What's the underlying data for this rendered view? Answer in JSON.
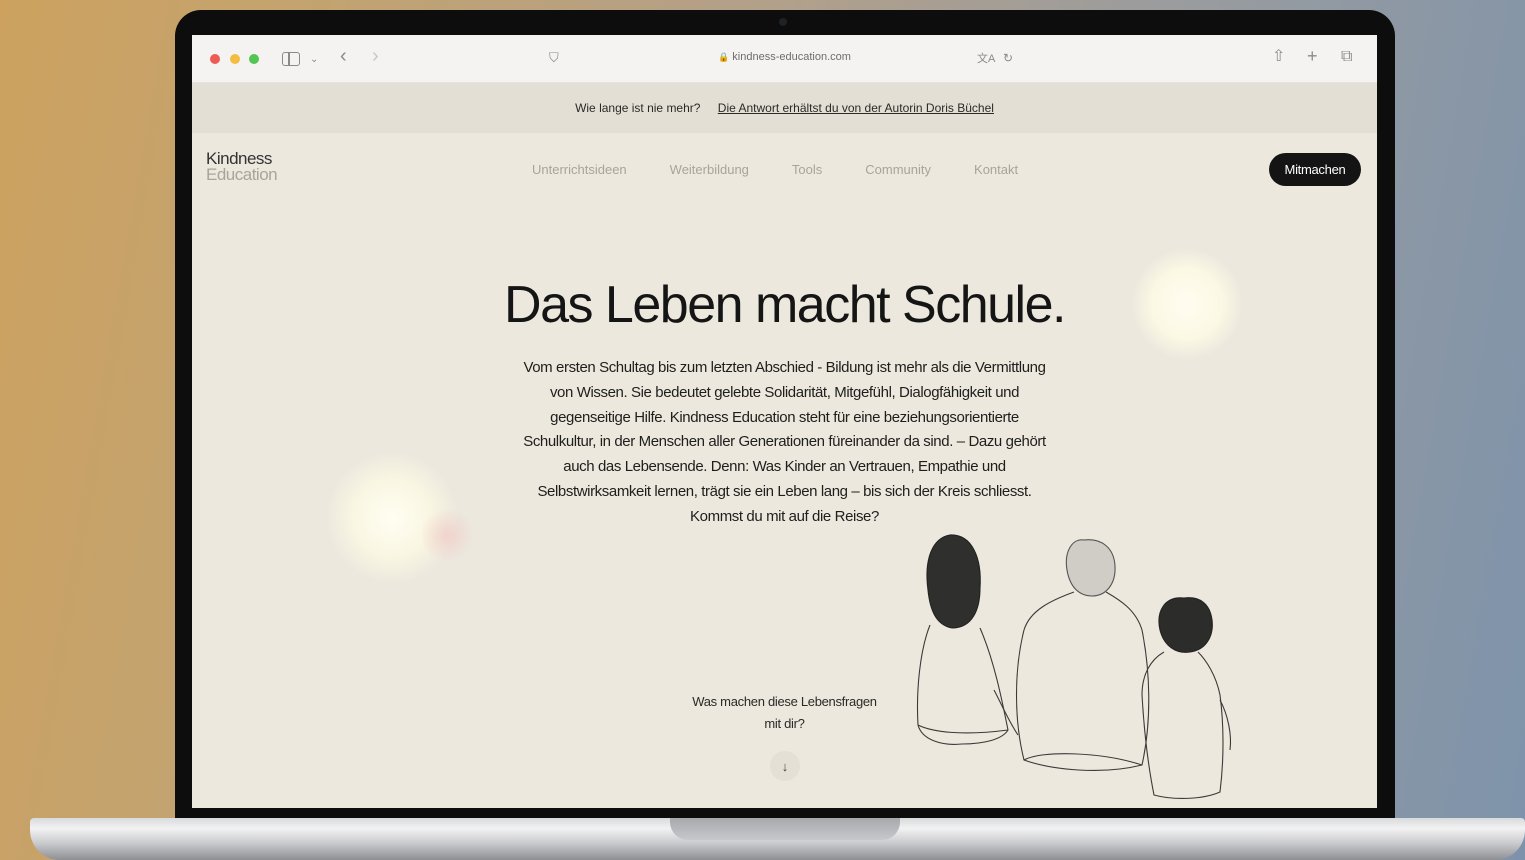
{
  "browser": {
    "url": "kindness-education.com",
    "icons": [
      "close-dot",
      "minimize-dot",
      "maximize-dot",
      "sidebar-icon",
      "chevron-down-icon",
      "back-icon",
      "forward-icon",
      "shield-icon",
      "translate-icon",
      "reload-icon",
      "share-icon",
      "new-tab-icon",
      "tabs-overview-icon"
    ]
  },
  "announcement": {
    "question": "Wie lange ist nie mehr?",
    "link": "Die Antwort erhältst du von der Autorin Doris Büchel"
  },
  "logo": {
    "line1": "Kindness",
    "line2": "Education"
  },
  "nav": {
    "items": [
      "Unterrichtsideen",
      "Weiterbildung",
      "Tools",
      "Community",
      "Kontakt"
    ],
    "cta": "Mitmachen"
  },
  "hero": {
    "title": "Das Leben macht Schule.",
    "body_lines": [
      "Vom ersten Schultag bis zum letzten Abschied - Bildung ist mehr als die Vermittlung",
      "von Wissen. Sie bedeutet gelebte Solidarität, Mitgefühl, Dialogfähigkeit und",
      "gegenseitige Hilfe. Kindness Education steht für eine beziehungsorientierte",
      "Schulkultur, in der Menschen aller Generationen füreinander da sind.  – Dazu gehört",
      "auch das Lebensende. Denn: Was Kinder an Vertrauen, Empathie und",
      "Selbstwirksamkeit lernen, trägt sie ein Leben lang – bis sich der Kreis schliesst.",
      "Kommst du mit auf die Reise?"
    ]
  },
  "prompt": {
    "line1": "Was machen diese Lebensfragen",
    "line2": "mit dir?",
    "scroll_icon": "↓"
  }
}
